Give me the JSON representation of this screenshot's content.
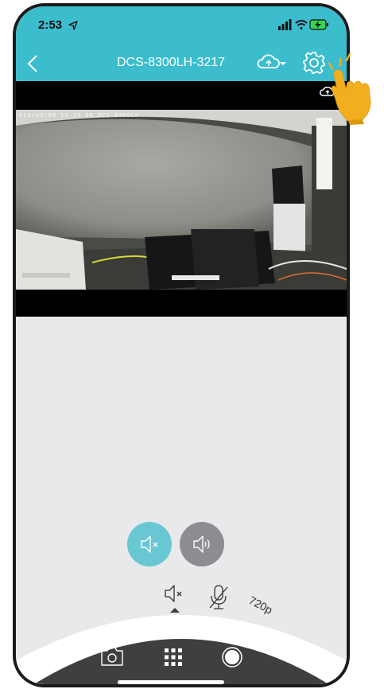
{
  "status_bar": {
    "time": "2:53"
  },
  "nav": {
    "title": "DCS-8300LH-3217"
  },
  "video": {
    "timestamp_overlay": "019/09/09  14 53 06    DCS-8300LH"
  },
  "audio_toggle": {
    "mute_selected": true
  },
  "control_arc": {
    "resolution_label": "720p"
  },
  "colors": {
    "accent": "#3bbdcd",
    "mute_active": "#68c7d3",
    "speaker_inactive": "#8b8d91",
    "bottom_bar": "#3f3f41",
    "hand": "#f2ae1e"
  }
}
